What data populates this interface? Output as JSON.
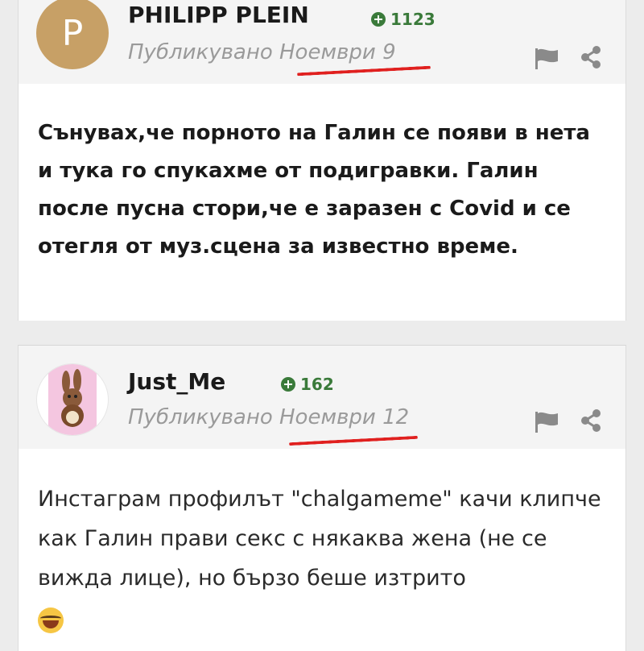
{
  "posts": [
    {
      "username": "PHILIPP PLEIN",
      "avatar_letter": "P",
      "reputation": "1123",
      "published": "Публикувано Ноември 9",
      "body": "Сънувах,че порното на Галин се появи в нета и тука го спукахме от подигравки. Галин после пусна стори,че е заразен с Covid и се отегля от муз.сцена за известно време."
    },
    {
      "username": "Just_Me",
      "avatar_icon": "bunny-avatar-icon",
      "reputation": "162",
      "published": "Публикувано Ноември 12",
      "body": "Инстаграм профилът \"chalgameme\" качи клипче как Галин прави секс с някаква жена (не се вижда лице), но бързо беше изтрито",
      "emoji": "laughing-tears-emoji-icon"
    }
  ],
  "icons": {
    "flag": "flag-icon",
    "share": "share-icon",
    "reputation": "plus-circle-icon"
  },
  "colors": {
    "reputation_green": "#3a7a3a",
    "annotation_red": "#e0201f",
    "avatar_gold": "#c7a066"
  }
}
